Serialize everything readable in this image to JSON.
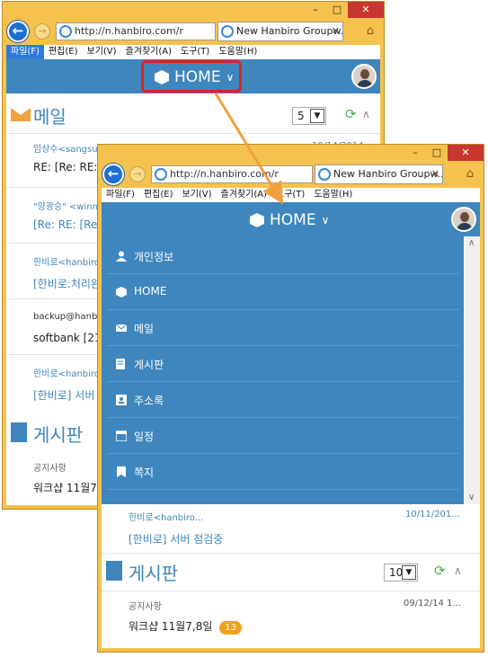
{
  "back_window": {
    "address": "http://n.hanbiro.com/r",
    "tab_title": "New Hanbiro Groupw...",
    "menu": [
      "파일(F)",
      "편집(E)",
      "보기(V)",
      "즐겨찾기(A)",
      "도구(T)",
      "도움말(H)"
    ],
    "header_title": "HOME",
    "mail_section": {
      "title": "메일",
      "count": "5",
      "items": [
        {
          "sender": "임상수<sangsu...",
          "date": "10/14/2014",
          "subject": "RE: [Re: RE: [R"
        },
        {
          "sender": "\"양광승\" <winn",
          "subject": "[Re: RE: [Re"
        },
        {
          "sender": "한비로<hanbiro",
          "subject": "[한비로:처리완"
        },
        {
          "sender": "backup@hanbir",
          "subject": "softbank [219"
        },
        {
          "sender": "한비로<hanbiro",
          "subject": "[한비로] 서버"
        }
      ]
    },
    "board_section": {
      "title": "게시판",
      "notice": "공지사항",
      "post": "워크샵 11월7,"
    }
  },
  "front_window": {
    "address": "http://n.hanbiro.com/r",
    "tab_title": "New Hanbiro Groupw...",
    "menu": [
      "파일(F)",
      "편집(E)",
      "보기(V)",
      "즐겨찾기(A)",
      "도구(T)",
      "도움말(H)"
    ],
    "header_title": "HOME",
    "dropdown": [
      {
        "label": "개인정보",
        "icon": "person-icon"
      },
      {
        "label": "HOME",
        "icon": "cube-icon"
      },
      {
        "label": "메일",
        "icon": "envelope-icon"
      },
      {
        "label": "게시판",
        "icon": "board-icon"
      },
      {
        "label": "주소록",
        "icon": "contacts-icon"
      },
      {
        "label": "일정",
        "icon": "calendar-icon"
      },
      {
        "label": "쪽지",
        "icon": "memo-icon"
      }
    ],
    "mail_last": {
      "sender": "한비로<hanbiro...",
      "date": "10/11/201...",
      "subject": "[한비로] 서버 점검중"
    },
    "board_section": {
      "title": "게시판",
      "count": "10",
      "notice": "공지사항",
      "notice_date": "09/12/14 1...",
      "post": "워크샵 11월7,8일",
      "badge": "13"
    }
  },
  "colors": {
    "accent": "#3e86bd",
    "window_frame": "#f6c24e",
    "highlight": "#e02020",
    "arrow": "#f0a040"
  }
}
